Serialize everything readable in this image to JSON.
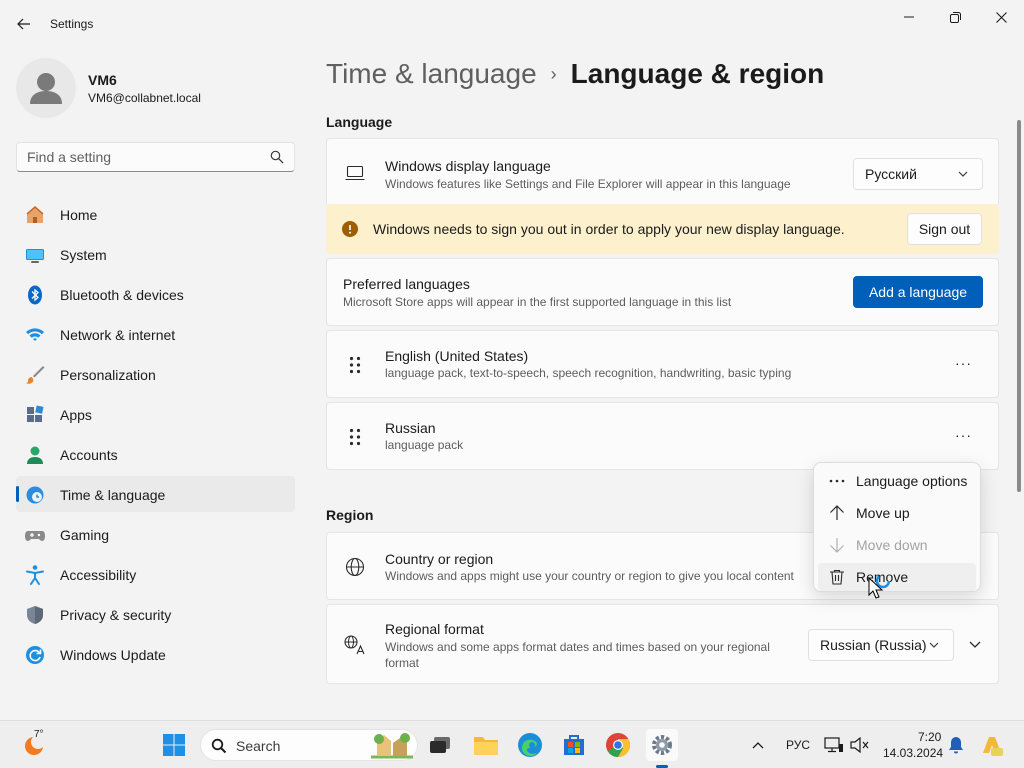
{
  "window": {
    "title": "Settings",
    "back_icon": "back-arrow-icon",
    "minimize_icon": "minimize-icon",
    "maximize_icon": "maximize-icon",
    "close_icon": "close-icon"
  },
  "user": {
    "name": "VM6",
    "email": "VM6@collabnet.local",
    "avatar_icon": "person-icon"
  },
  "search": {
    "placeholder": "Find a setting",
    "icon": "search-icon"
  },
  "sidebar": {
    "items": [
      {
        "label": "Home",
        "icon": "home-icon",
        "active": false
      },
      {
        "label": "System",
        "icon": "system-icon",
        "active": false
      },
      {
        "label": "Bluetooth & devices",
        "icon": "bluetooth-icon",
        "active": false
      },
      {
        "label": "Network & internet",
        "icon": "wifi-icon",
        "active": false
      },
      {
        "label": "Personalization",
        "icon": "brush-icon",
        "active": false
      },
      {
        "label": "Apps",
        "icon": "apps-icon",
        "active": false
      },
      {
        "label": "Accounts",
        "icon": "accounts-icon",
        "active": false
      },
      {
        "label": "Time & language",
        "icon": "time-language-icon",
        "active": true
      },
      {
        "label": "Gaming",
        "icon": "gamepad-icon",
        "active": false
      },
      {
        "label": "Accessibility",
        "icon": "accessibility-icon",
        "active": false
      },
      {
        "label": "Privacy & security",
        "icon": "shield-icon",
        "active": false
      },
      {
        "label": "Windows Update",
        "icon": "update-icon",
        "active": false
      }
    ]
  },
  "breadcrumb": {
    "parent": "Time & language",
    "separator": "›",
    "current": "Language & region"
  },
  "language": {
    "section_title": "Language",
    "display": {
      "title": "Windows display language",
      "desc": "Windows features like Settings and File Explorer will appear in this language",
      "value": "Русский",
      "icon": "laptop-icon"
    },
    "warning": {
      "text": "Windows needs to sign you out in order to apply your new display language.",
      "button": "Sign out",
      "icon": "warning-icon",
      "color": "#9d5d00"
    },
    "preferred": {
      "title": "Preferred languages",
      "desc": "Microsoft Store apps will appear in the first supported language in this list",
      "button": "Add a language"
    },
    "list": [
      {
        "name": "English (United States)",
        "features": "language pack, text-to-speech, speech recognition, handwriting, basic typing"
      },
      {
        "name": "Russian",
        "features": "language pack"
      }
    ],
    "more_label": "···"
  },
  "context_menu": {
    "items": [
      {
        "label": "Language options",
        "icon": "more-icon",
        "enabled": true
      },
      {
        "label": "Move up",
        "icon": "arrow-up-icon",
        "enabled": true
      },
      {
        "label": "Move down",
        "icon": "arrow-down-icon",
        "enabled": false
      },
      {
        "label": "Remove",
        "icon": "trash-icon",
        "enabled": true
      }
    ]
  },
  "region": {
    "section_title": "Region",
    "country": {
      "title": "Country or region",
      "desc": "Windows and apps might use your country or region to give you local content",
      "icon": "globe-icon"
    },
    "format": {
      "title": "Regional format",
      "desc": "Windows and some apps format dates and times based on your regional format",
      "value": "Russian (Russia)",
      "icon": "regional-format-icon"
    }
  },
  "taskbar": {
    "weather_temp": "7°",
    "search_label": "Search",
    "lang_indicator": "РУС",
    "time": "7:20",
    "date": "14.03.2024"
  },
  "colors": {
    "accent": "#005fb8",
    "warning_bg": "#fcf0cd",
    "background": "#f3f3f3"
  }
}
